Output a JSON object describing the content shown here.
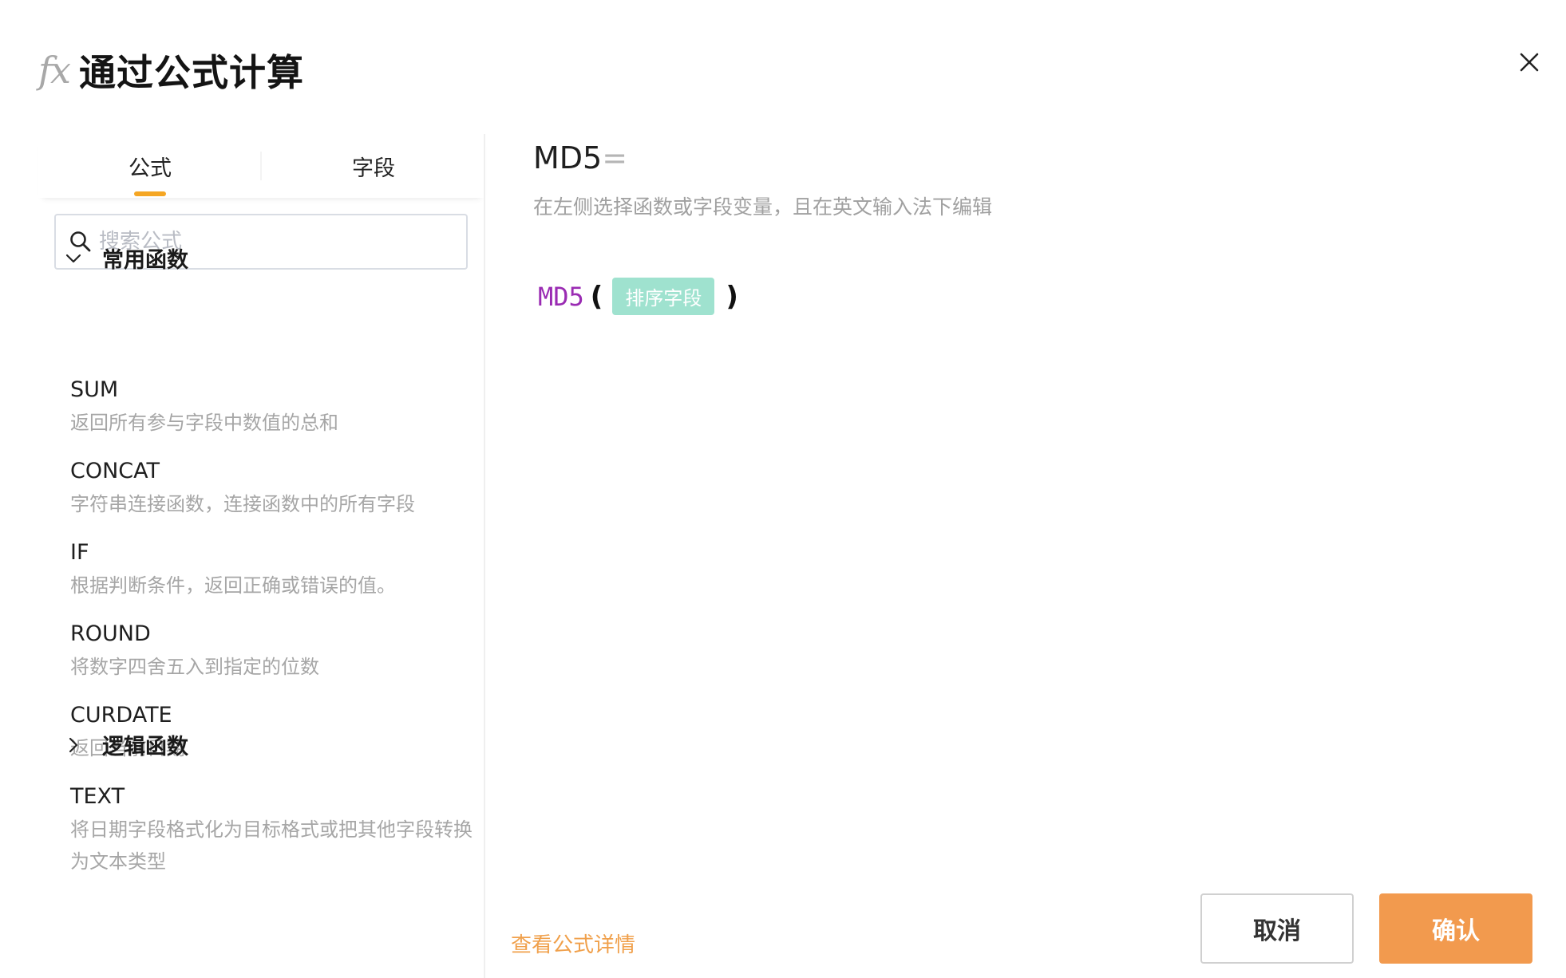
{
  "dialog": {
    "icon_glyph": "fx",
    "title": "通过公式计算"
  },
  "tabs": [
    {
      "label": "公式",
      "active": true
    },
    {
      "label": "字段",
      "active": false
    }
  ],
  "search": {
    "placeholder": "搜索公式",
    "value": ""
  },
  "groups": {
    "common": {
      "label": "常用函数",
      "expanded": true
    },
    "logic": {
      "label": "逻辑函数",
      "expanded": false
    }
  },
  "functions": [
    {
      "name": "SUM",
      "desc": "返回所有参与字段中数值的总和"
    },
    {
      "name": "CONCAT",
      "desc": "字符串连接函数，连接函数中的所有字段"
    },
    {
      "name": "IF",
      "desc": "根据判断条件，返回正确或错误的值。"
    },
    {
      "name": "ROUND",
      "desc": "将数字四舍五入到指定的位数"
    },
    {
      "name": "CURDATE",
      "desc": "返回当前日期"
    },
    {
      "name": "TEXT",
      "desc": "将日期字段格式化为目标格式或把其他字段转换为文本类型"
    }
  ],
  "editor": {
    "formula_name": "MD5",
    "equals": "=",
    "hint": "在左侧选择函数或字段变量，且在英文输入法下编辑",
    "fn_token": "MD5",
    "open_paren": "(",
    "close_paren": ")",
    "field_token": "排序字段"
  },
  "footer": {
    "detail_link": "查看公式详情",
    "cancel_label": "取消",
    "confirm_label": "确认"
  },
  "colors": {
    "accent": "#f5a623",
    "confirm_bg": "#f29a4e",
    "link": "#f0a04b",
    "fn_token": "#9a2bb3",
    "field_chip": "#9fe2cf"
  }
}
